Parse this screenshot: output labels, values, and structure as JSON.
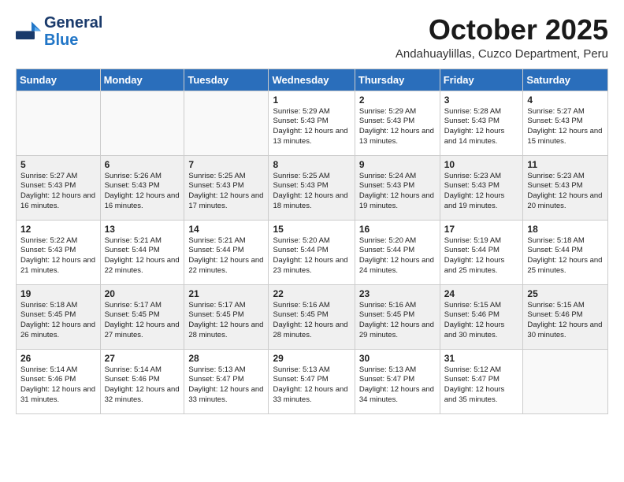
{
  "header": {
    "logo_line1": "General",
    "logo_line2": "Blue",
    "month": "October 2025",
    "location": "Andahuaylillas, Cuzco Department, Peru"
  },
  "days_of_week": [
    "Sunday",
    "Monday",
    "Tuesday",
    "Wednesday",
    "Thursday",
    "Friday",
    "Saturday"
  ],
  "weeks": [
    [
      {
        "day": "",
        "info": ""
      },
      {
        "day": "",
        "info": ""
      },
      {
        "day": "",
        "info": ""
      },
      {
        "day": "1",
        "info": "Sunrise: 5:29 AM\nSunset: 5:43 PM\nDaylight: 12 hours\nand 13 minutes."
      },
      {
        "day": "2",
        "info": "Sunrise: 5:29 AM\nSunset: 5:43 PM\nDaylight: 12 hours\nand 13 minutes."
      },
      {
        "day": "3",
        "info": "Sunrise: 5:28 AM\nSunset: 5:43 PM\nDaylight: 12 hours\nand 14 minutes."
      },
      {
        "day": "4",
        "info": "Sunrise: 5:27 AM\nSunset: 5:43 PM\nDaylight: 12 hours\nand 15 minutes."
      }
    ],
    [
      {
        "day": "5",
        "info": "Sunrise: 5:27 AM\nSunset: 5:43 PM\nDaylight: 12 hours\nand 16 minutes."
      },
      {
        "day": "6",
        "info": "Sunrise: 5:26 AM\nSunset: 5:43 PM\nDaylight: 12 hours\nand 16 minutes."
      },
      {
        "day": "7",
        "info": "Sunrise: 5:25 AM\nSunset: 5:43 PM\nDaylight: 12 hours\nand 17 minutes."
      },
      {
        "day": "8",
        "info": "Sunrise: 5:25 AM\nSunset: 5:43 PM\nDaylight: 12 hours\nand 18 minutes."
      },
      {
        "day": "9",
        "info": "Sunrise: 5:24 AM\nSunset: 5:43 PM\nDaylight: 12 hours\nand 19 minutes."
      },
      {
        "day": "10",
        "info": "Sunrise: 5:23 AM\nSunset: 5:43 PM\nDaylight: 12 hours\nand 19 minutes."
      },
      {
        "day": "11",
        "info": "Sunrise: 5:23 AM\nSunset: 5:43 PM\nDaylight: 12 hours\nand 20 minutes."
      }
    ],
    [
      {
        "day": "12",
        "info": "Sunrise: 5:22 AM\nSunset: 5:43 PM\nDaylight: 12 hours\nand 21 minutes."
      },
      {
        "day": "13",
        "info": "Sunrise: 5:21 AM\nSunset: 5:44 PM\nDaylight: 12 hours\nand 22 minutes."
      },
      {
        "day": "14",
        "info": "Sunrise: 5:21 AM\nSunset: 5:44 PM\nDaylight: 12 hours\nand 22 minutes."
      },
      {
        "day": "15",
        "info": "Sunrise: 5:20 AM\nSunset: 5:44 PM\nDaylight: 12 hours\nand 23 minutes."
      },
      {
        "day": "16",
        "info": "Sunrise: 5:20 AM\nSunset: 5:44 PM\nDaylight: 12 hours\nand 24 minutes."
      },
      {
        "day": "17",
        "info": "Sunrise: 5:19 AM\nSunset: 5:44 PM\nDaylight: 12 hours\nand 25 minutes."
      },
      {
        "day": "18",
        "info": "Sunrise: 5:18 AM\nSunset: 5:44 PM\nDaylight: 12 hours\nand 25 minutes."
      }
    ],
    [
      {
        "day": "19",
        "info": "Sunrise: 5:18 AM\nSunset: 5:45 PM\nDaylight: 12 hours\nand 26 minutes."
      },
      {
        "day": "20",
        "info": "Sunrise: 5:17 AM\nSunset: 5:45 PM\nDaylight: 12 hours\nand 27 minutes."
      },
      {
        "day": "21",
        "info": "Sunrise: 5:17 AM\nSunset: 5:45 PM\nDaylight: 12 hours\nand 28 minutes."
      },
      {
        "day": "22",
        "info": "Sunrise: 5:16 AM\nSunset: 5:45 PM\nDaylight: 12 hours\nand 28 minutes."
      },
      {
        "day": "23",
        "info": "Sunrise: 5:16 AM\nSunset: 5:45 PM\nDaylight: 12 hours\nand 29 minutes."
      },
      {
        "day": "24",
        "info": "Sunrise: 5:15 AM\nSunset: 5:46 PM\nDaylight: 12 hours\nand 30 minutes."
      },
      {
        "day": "25",
        "info": "Sunrise: 5:15 AM\nSunset: 5:46 PM\nDaylight: 12 hours\nand 30 minutes."
      }
    ],
    [
      {
        "day": "26",
        "info": "Sunrise: 5:14 AM\nSunset: 5:46 PM\nDaylight: 12 hours\nand 31 minutes."
      },
      {
        "day": "27",
        "info": "Sunrise: 5:14 AM\nSunset: 5:46 PM\nDaylight: 12 hours\nand 32 minutes."
      },
      {
        "day": "28",
        "info": "Sunrise: 5:13 AM\nSunset: 5:47 PM\nDaylight: 12 hours\nand 33 minutes."
      },
      {
        "day": "29",
        "info": "Sunrise: 5:13 AM\nSunset: 5:47 PM\nDaylight: 12 hours\nand 33 minutes."
      },
      {
        "day": "30",
        "info": "Sunrise: 5:13 AM\nSunset: 5:47 PM\nDaylight: 12 hours\nand 34 minutes."
      },
      {
        "day": "31",
        "info": "Sunrise: 5:12 AM\nSunset: 5:47 PM\nDaylight: 12 hours\nand 35 minutes."
      },
      {
        "day": "",
        "info": ""
      }
    ]
  ]
}
